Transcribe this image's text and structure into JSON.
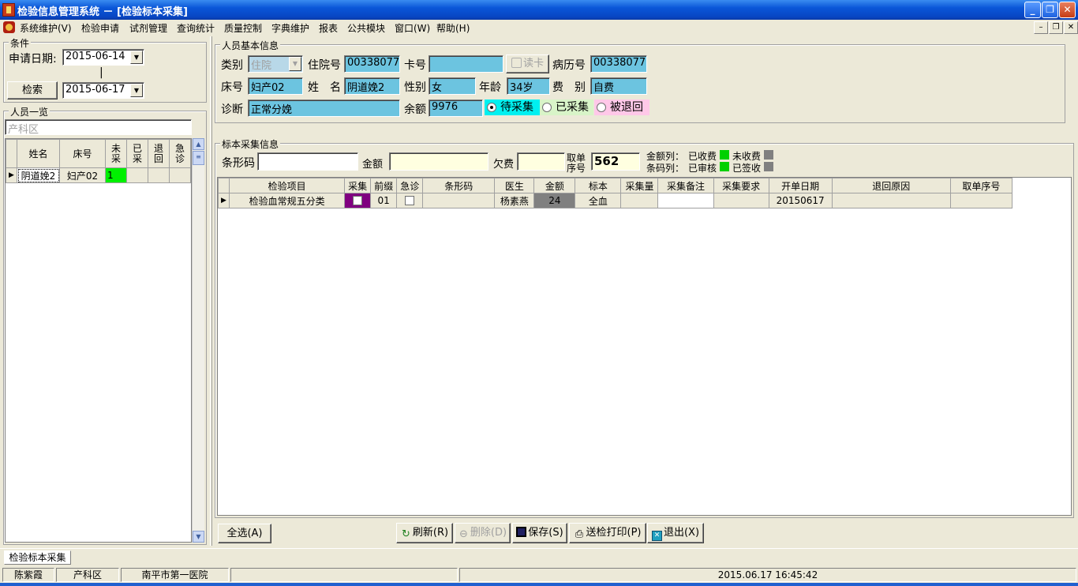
{
  "window": {
    "title": "检验信息管理系统 － [检验标本采集]",
    "buttons": {
      "minimize": "_",
      "restore": "❐",
      "close": "✕"
    }
  },
  "menu": {
    "items": [
      "系统维护(V)",
      "检验申请",
      "试剂管理",
      "查询统计",
      "质量控制",
      "字典维护",
      "报表",
      "公共模块",
      "窗口(W)",
      "帮助(H)"
    ],
    "mdi_buttons": {
      "minimize": "–",
      "restore": "❐",
      "close": "✕"
    }
  },
  "conditions": {
    "group_label": "条件",
    "date_label": "申请日期:",
    "date_from": "2015-06-14",
    "separator": "|",
    "search_button": "检索",
    "date_to": "2015-06-17"
  },
  "person_list": {
    "group_label": "人员一览",
    "ward_placeholder": "产科区",
    "columns": [
      "姓名",
      "床号",
      "未采",
      "已采",
      "退回",
      "急诊"
    ],
    "rows": [
      {
        "name": "阴道娩2",
        "bed": "妇产02",
        "not_collected": "1",
        "collected": "",
        "returned": "",
        "urgent": ""
      }
    ]
  },
  "basic_info": {
    "group_label": "人员基本信息",
    "category_label": "类别",
    "category_value": "住院",
    "inpatient_no_label": "住院号",
    "inpatient_no": "00338077",
    "card_no_label": "卡号",
    "card_no": "",
    "read_card_button": "读卡",
    "record_no_label": "病历号",
    "record_no": "00338077",
    "bed_label": "床号",
    "bed": "妇产02",
    "name_label": "姓　名",
    "name": "阴道娩2",
    "sex_label": "性别",
    "sex": "女",
    "age_label": "年龄",
    "age": "34岁",
    "fee_type_label": "费　别",
    "fee_type": "自费",
    "diagnosis_label": "诊断",
    "diagnosis": "正常分娩",
    "balance_label": "余额",
    "balance": "9976",
    "status_options": [
      {
        "label": "待采集",
        "selected": true,
        "color": "#00f0f0"
      },
      {
        "label": "已采集",
        "selected": false,
        "color": "#d8f4c8"
      },
      {
        "label": "被退回",
        "selected": false,
        "color": "#ffc8e8"
      }
    ]
  },
  "sample_info": {
    "group_label": "标本采集信息",
    "barcode_label": "条形码",
    "barcode": "",
    "amount_label": "金额",
    "amount": "",
    "arrears_label": "欠费",
    "arrears": "",
    "ticket_label_1": "取单",
    "ticket_label_2": "序号",
    "ticket_no": "562",
    "legend": {
      "amount_col": "金额列：",
      "charged": "已收费",
      "uncharged": "未收费",
      "barcode_col": "条码列：",
      "audited": "已审核",
      "signed": "已签收",
      "charged_color": "#00d000",
      "uncharged_color": "#808080",
      "audited_color": "#00d000",
      "signed_color": "#808080"
    },
    "columns": [
      "检验项目",
      "采集",
      "前缀",
      "急诊",
      "条形码",
      "医生",
      "金额",
      "标本",
      "采集量",
      "采集备注",
      "采集要求",
      "开单日期",
      "退回原因",
      "取单序号"
    ],
    "rows": [
      {
        "item": "检验血常规五分类",
        "collect": true,
        "prefix": "01",
        "urgent": false,
        "barcode": "",
        "doctor": "杨素燕",
        "amount": "24",
        "specimen": "全血",
        "volume": "",
        "note": "",
        "requirement": "",
        "date": "20150617",
        "return_reason": "",
        "ticket": ""
      }
    ]
  },
  "actions": {
    "select_all": "全选(A)",
    "refresh": "刷新(R)",
    "delete": "删除(D)",
    "save": "保存(S)",
    "print": "送检打印(P)",
    "exit": "退出(X)"
  },
  "tab": {
    "label": "检验标本采集"
  },
  "statusbar": {
    "user": "陈紫霞",
    "ward": "产科区",
    "hospital": "南平市第一医院",
    "datetime": "2015.06.17  16:45:42"
  }
}
